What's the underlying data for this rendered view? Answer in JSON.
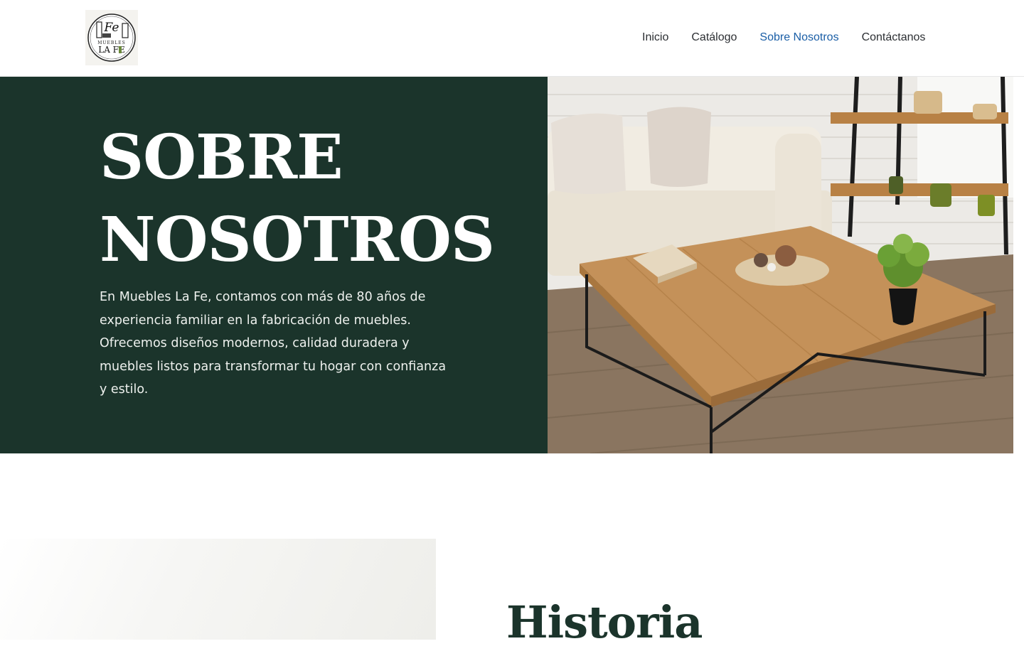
{
  "brand": {
    "logo_top": "Fe",
    "logo_mid": "MUEBLES",
    "logo_bottom": "LA FE"
  },
  "nav": {
    "items": [
      {
        "label": "Inicio",
        "active": false
      },
      {
        "label": "Catálogo",
        "active": false
      },
      {
        "label": "Sobre Nosotros",
        "active": true
      },
      {
        "label": "Contáctanos",
        "active": false
      }
    ],
    "active_color": "#1a5ea6"
  },
  "hero": {
    "title_line1": "SOBRE",
    "title_line2": "NOSOTROS",
    "description": "En Muebles La Fe, contamos con más de 80 años de experiencia familiar en la fabricación de muebles. Ofrecemos diseños modernos, calidad duradera y muebles listos para transformar tu hogar con confianza y estilo.",
    "background_color": "#1b342b"
  },
  "history": {
    "title": "Historia"
  }
}
